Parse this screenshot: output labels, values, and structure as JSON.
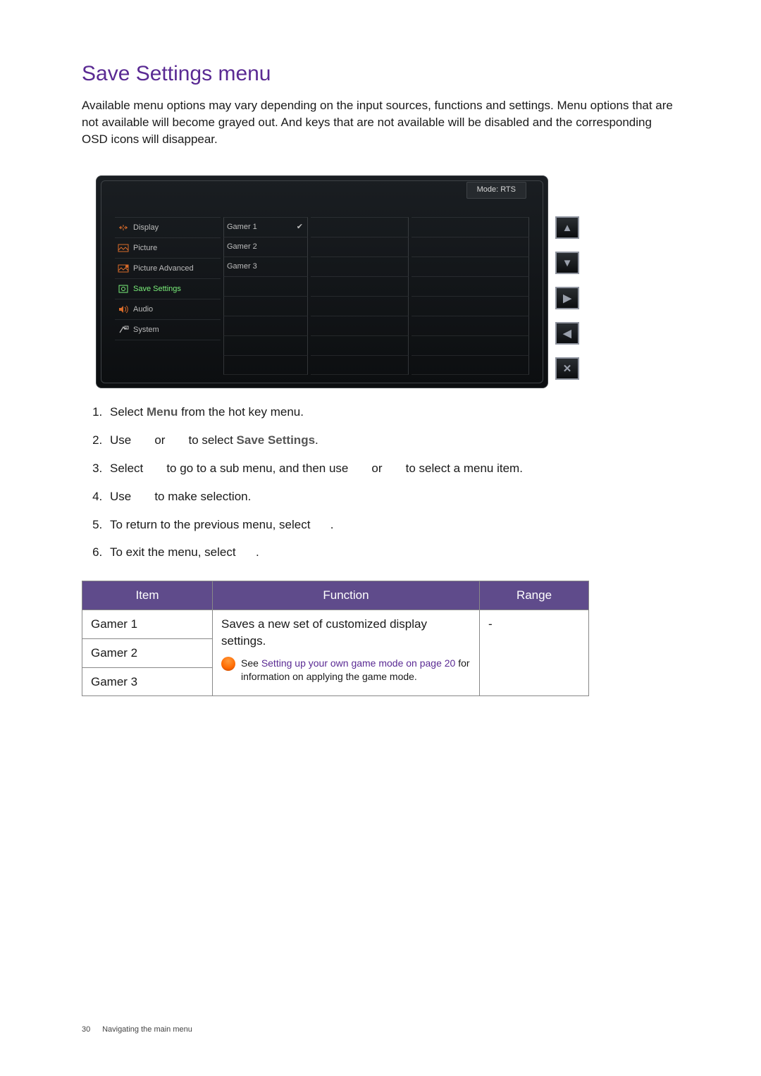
{
  "title": "Save Settings menu",
  "intro": "Available menu options may vary depending on the input sources, functions and settings. Menu options that are not available will become grayed out. And keys that are not available will be disabled and the corresponding OSD icons will disappear.",
  "osd": {
    "mode_label": "Mode: RTS",
    "nav": {
      "display": "Display",
      "picture": "Picture",
      "picture_advanced": "Picture Advanced",
      "save_settings": "Save Settings",
      "audio": "Audio",
      "system": "System"
    },
    "sub": {
      "g1": "Gamer 1",
      "g1_check": "✔",
      "g2": "Gamer 2",
      "g3": "Gamer 3"
    },
    "buttons": {
      "up": "▲",
      "down": "▼",
      "right": "▶",
      "left": "◀",
      "close": "✕"
    }
  },
  "steps": {
    "s1a": "Select ",
    "s1_menu": "Menu",
    "s1b": " from the hot key menu.",
    "s2a": "Use ",
    "s2_or": " or ",
    "s2b": " to select ",
    "s2_save": "Save Settings",
    "s2c": ".",
    "s3a": "Select ",
    "s3b": " to go to a sub menu, and then use ",
    "s3_or": " or ",
    "s3c": " to select a menu item.",
    "s4a": "Use ",
    "s4b": " to make selection.",
    "s5a": "To return to the previous menu, select ",
    "s5b": ".",
    "s6a": "To exit the menu, select ",
    "s6b": "."
  },
  "table": {
    "h_item": "Item",
    "h_function": "Function",
    "h_range": "Range",
    "row1_item": "Gamer 1",
    "row2_item": "Gamer 2",
    "row3_item": "Gamer 3",
    "func_line1": "Saves a new set of customized display settings.",
    "tip_a": "See ",
    "tip_link": "Setting up your own game mode on page 20",
    "tip_b": " for information on applying the game mode.",
    "range": "-"
  },
  "footer": {
    "page": "30",
    "section": "Navigating the main menu"
  }
}
